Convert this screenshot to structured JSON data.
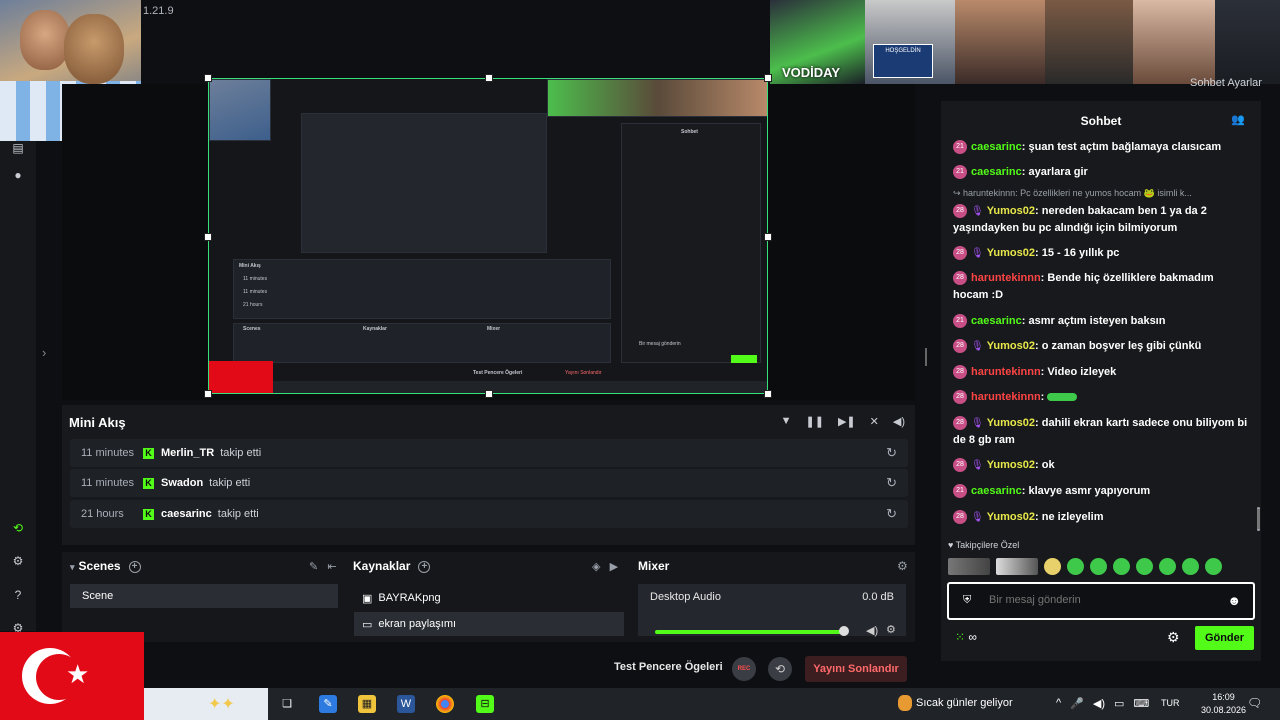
{
  "app": {
    "version": "1.21.9"
  },
  "cams": {
    "vodiday_label": "VODİDAY",
    "hosgeldin": "HOŞGELDİN"
  },
  "chat_header_partial": "Sohbet Ayarlar",
  "preview": {
    "mini_title": "Mini Akış",
    "rows": [
      "11 minutes",
      "11 minutes",
      "21 hours"
    ],
    "scenes": "Scenes",
    "sources": "Kaynaklar",
    "mixer": "Mixer",
    "test": "Test Pencere Ögeleri",
    "end": "Yayını Sonlandır",
    "chat_title": "Sohbet",
    "input": "Bir mesaj gönderin",
    "send": "Gönder"
  },
  "feed": {
    "title": "Mini Akış",
    "rows": [
      {
        "time": "11 minutes",
        "user": "Merlin_TR",
        "action": "takip etti"
      },
      {
        "time": "11 minutes",
        "user": "Swadon",
        "action": "takip etti"
      },
      {
        "time": "21 hours",
        "user": "caesarinc",
        "action": "takip etti"
      }
    ]
  },
  "scenes": {
    "title": "Scenes",
    "items": [
      "Scene"
    ]
  },
  "sources": {
    "title": "Kaynaklar",
    "items": [
      "BAYRAKpng",
      "ekran paylaşımı"
    ]
  },
  "mixer": {
    "title": "Mixer",
    "channel": "Desktop Audio",
    "db": "0.0 dB",
    "level": 0.93
  },
  "actions": {
    "test_label": "Test Pencere Ögeleri",
    "rec_label": "REC",
    "end_label": "Yayını Sonlandır"
  },
  "chat": {
    "title": "Sohbet",
    "messages": [
      {
        "badge": "21",
        "user": "caesarinc",
        "color": "#53fc18",
        "text": "şuan test açtım bağlamaya claısıcam",
        "mic": false
      },
      {
        "badge": "21",
        "user": "caesarinc",
        "color": "#53fc18",
        "text": "ayarlara gir",
        "mic": false
      },
      {
        "reply": "↪ haruntekinnn: Pc özellikleri ne yumos hocam 🐸 isimli k..."
      },
      {
        "badge": "28",
        "user": "Yumos02",
        "color": "#e8e84a",
        "text": "nereden bakacam ben 1 ya da 2 yaşındayken bu pc alındığı için bilmiyorum",
        "mic": true
      },
      {
        "badge": "28",
        "user": "Yumos02",
        "color": "#e8e84a",
        "text": "15 - 16 yıllık pc",
        "mic": true
      },
      {
        "badge": "28",
        "user": "haruntekinnn",
        "color": "#ff4444",
        "text": "Bende hiç özelliklere bakmadım hocam :D",
        "mic": false
      },
      {
        "badge": "21",
        "user": "caesarinc",
        "color": "#53fc18",
        "text": "asmr açtım isteyen baksın",
        "mic": false
      },
      {
        "badge": "28",
        "user": "Yumos02",
        "color": "#e8e84a",
        "text": "o zaman boşver leş gibi çünkü",
        "mic": true
      },
      {
        "badge": "28",
        "user": "haruntekinnn",
        "color": "#ff4444",
        "text": "Video izleyek",
        "mic": false
      },
      {
        "badge": "28",
        "user": "haruntekinnn",
        "color": "#ff4444",
        "text": "",
        "mic": false,
        "emote": true
      },
      {
        "badge": "28",
        "user": "Yumos02",
        "color": "#e8e84a",
        "text": "dahili ekran kartı sadece onu biliyom bi de 8 gb ram",
        "mic": true
      },
      {
        "badge": "28",
        "user": "Yumos02",
        "color": "#e8e84a",
        "text": "ok",
        "mic": true
      },
      {
        "badge": "21",
        "user": "caesarinc",
        "color": "#53fc18",
        "text": "klavye asmr yapıyorum",
        "mic": false
      },
      {
        "badge": "28",
        "user": "Yumos02",
        "color": "#e8e84a",
        "text": "ne izleyelim",
        "mic": true
      }
    ],
    "followers_label": "♥ Takipçilere Özel",
    "input_placeholder": "Bir mesaj gönderin",
    "footer_icon": "∞",
    "send_label": "Gönder"
  },
  "taskbar": {
    "weather": "Sıcak günler geliyor",
    "lang": "TUR",
    "time": "16:09",
    "date": "30.08.2026"
  }
}
